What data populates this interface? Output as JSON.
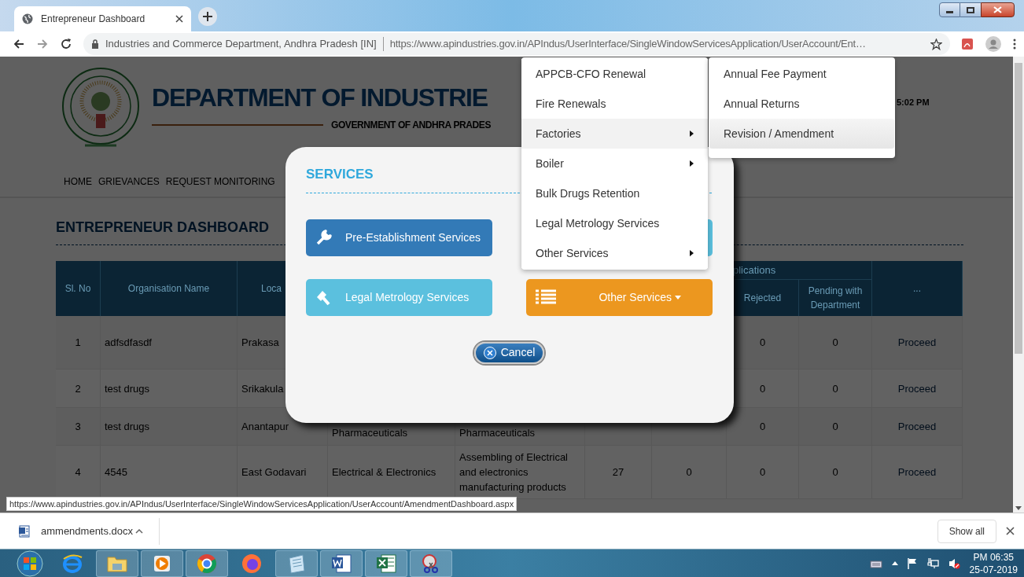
{
  "browser": {
    "tab": {
      "title": "Entrepreneur Dashboard",
      "selected": true
    },
    "address": {
      "site": "Industries and Commerce Department, Andhra Pradesh [IN]",
      "url": "https://www.apindustries.gov.in/APIndus/UserInterface/SingleWindowServicesApplication/UserAccount/Ent…"
    },
    "status_url": "https://www.apindustries.gov.in/APIndus/UserInterface/SingleWindowServicesApplication/UserAccount/AmendmentDashboard.aspx"
  },
  "page": {
    "title": "DEPARTMENT OF INDUSTRIE",
    "subtitle": "GOVERNMENT OF ANDHRA PRADES",
    "time": "5:02 PM",
    "nav": [
      "HOME",
      "GRIEVANCES",
      "REQUEST MONITORING"
    ],
    "dashboard_title": "ENTREPRENEUR DASHBOARD",
    "table": {
      "columns": [
        "Sl. No",
        "Organisation Name",
        "Loca"
      ],
      "group_header": "plications",
      "sub_columns": [
        "Rejected",
        "Pending with Department"
      ],
      "last_column": "...",
      "rows": [
        {
          "sl_no": "1",
          "organisation": "adfsdfasdf",
          "location": "Prakasa",
          "rejected": "0",
          "pending": "0",
          "action": "Proceed"
        },
        {
          "sl_no": "2",
          "organisation": "test drugs",
          "location": "Srikakula",
          "rejected": "0",
          "pending": "0",
          "action": "Proceed"
        },
        {
          "sl_no": "3",
          "organisation": "test drugs",
          "location": "Anantapur",
          "column_4": "Pharmaceuticals",
          "column_5": "Pharmaceuticals",
          "rejected": "0",
          "pending": "0",
          "action": "Proceed"
        },
        {
          "sl_no": "4",
          "organisation": "4545",
          "location": "East Godavari",
          "column_4": "Electrical & Electronics",
          "column_5": "Assembling of Electrical and electronics manufacturing products",
          "column_6": "27",
          "column_7": "0",
          "rejected": "0",
          "pending": "0",
          "action": "Proceed"
        }
      ]
    }
  },
  "modal": {
    "title": "SERVICES",
    "buttons": [
      {
        "label": "Pre-Establishment Services",
        "kind": "wrench"
      },
      {
        "label": "Legal Metrology Services",
        "kind": "gavel"
      },
      {
        "label": "Other Services",
        "kind": "dropdown"
      }
    ],
    "cancel": "Cancel"
  },
  "menu": {
    "items": [
      {
        "label": "APPCB-CFO Renewal",
        "submenu": false,
        "selected": false
      },
      {
        "label": "Fire Renewals",
        "submenu": false,
        "selected": false
      },
      {
        "label": "Factories",
        "submenu": true,
        "selected": true
      },
      {
        "label": "Boiler",
        "submenu": true,
        "selected": false
      },
      {
        "label": "Bulk Drugs Retention",
        "submenu": false,
        "selected": false
      },
      {
        "label": "Legal Metrology Services",
        "submenu": false,
        "selected": false
      },
      {
        "label": "Other Services",
        "submenu": true,
        "selected": false
      }
    ],
    "submenu": [
      {
        "label": "Annual Fee Payment",
        "selected": false
      },
      {
        "label": "Annual Returns",
        "selected": false
      },
      {
        "label": "Revision / Amendment",
        "selected": true
      }
    ]
  },
  "downloads": {
    "file": "ammendments.docx",
    "show_all": "Show all"
  },
  "taskbar": {
    "time": "PM 06:35",
    "date": "25-07-2019"
  }
}
